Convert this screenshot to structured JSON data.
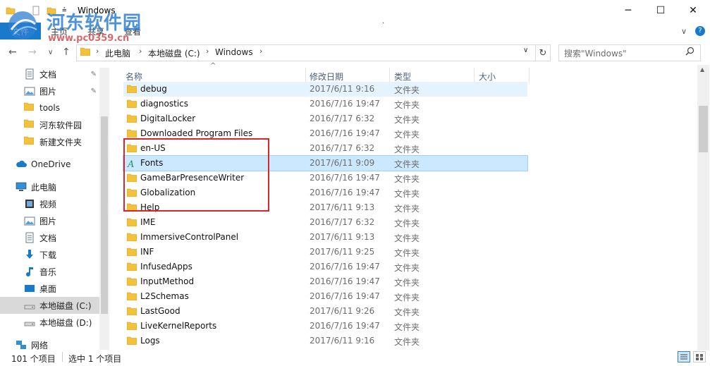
{
  "window": {
    "title": "Windows",
    "minimize_glyph": "─",
    "maximize_glyph": "☐",
    "close_glyph": "✕"
  },
  "ribbon": {
    "file_tab": "文件",
    "tabs": [
      "主页",
      "共享",
      "查看"
    ],
    "collapse_glyph": "∨",
    "help_glyph": "?"
  },
  "watermark": {
    "title": "河东软件园",
    "url": "www.pc0359.cn"
  },
  "nav": {
    "back_glyph": "←",
    "forward_glyph": "→",
    "recent_glyph": "∨",
    "up_glyph": "↑",
    "breadcrumbs": [
      "此电脑",
      "本地磁盘 (C:)",
      "Windows"
    ],
    "crumb_sep": "›",
    "dropdown_glyph": "∨",
    "refresh_glyph": "↻"
  },
  "search": {
    "placeholder": "搜索\"Windows\"",
    "icon": "search-icon"
  },
  "sidebar": {
    "items": [
      {
        "label": "文档",
        "icon": "document-icon",
        "pinned": true
      },
      {
        "label": "图片",
        "icon": "picture-icon",
        "pinned": true
      },
      {
        "label": "tools",
        "icon": "folder-icon",
        "pinned": false
      },
      {
        "label": "河东软件园",
        "icon": "folder-icon",
        "pinned": false
      },
      {
        "label": "新建文件夹",
        "icon": "folder-icon",
        "pinned": false
      },
      {
        "label": "OneDrive",
        "icon": "cloud-icon",
        "pinned": false
      },
      {
        "label": "此电脑",
        "icon": "computer-icon",
        "pinned": false
      },
      {
        "label": "视频",
        "icon": "video-icon",
        "pinned": false
      },
      {
        "label": "图片",
        "icon": "picture-icon",
        "pinned": false
      },
      {
        "label": "文档",
        "icon": "document-icon",
        "pinned": false
      },
      {
        "label": "下载",
        "icon": "download-icon",
        "pinned": false
      },
      {
        "label": "音乐",
        "icon": "music-icon",
        "pinned": false
      },
      {
        "label": "桌面",
        "icon": "desktop-icon",
        "pinned": false
      },
      {
        "label": "本地磁盘 (C:)",
        "icon": "drive-icon",
        "pinned": false,
        "selected": true
      },
      {
        "label": "本地磁盘 (D:)",
        "icon": "drive-icon",
        "pinned": false
      },
      {
        "label": "网络",
        "icon": "network-icon",
        "pinned": false
      }
    ],
    "pin_glyph": "✎"
  },
  "columns": {
    "name": "名称",
    "modified": "修改日期",
    "type": "类型",
    "size": "大小",
    "sort_glyph": "^"
  },
  "files": [
    {
      "name": "debug",
      "modified": "2017/6/11 9:16",
      "type": "文件夹",
      "icon": "folder-icon",
      "state": "hover"
    },
    {
      "name": "diagnostics",
      "modified": "2016/7/16 19:47",
      "type": "文件夹",
      "icon": "folder-icon"
    },
    {
      "name": "DigitalLocker",
      "modified": "2016/7/17 6:32",
      "type": "文件夹",
      "icon": "folder-icon"
    },
    {
      "name": "Downloaded Program Files",
      "modified": "2016/7/16 19:47",
      "type": "文件夹",
      "icon": "folder-icon"
    },
    {
      "name": "en-US",
      "modified": "2016/7/17 6:32",
      "type": "文件夹",
      "icon": "folder-icon"
    },
    {
      "name": "Fonts",
      "modified": "2017/6/11 9:09",
      "type": "文件夹",
      "icon": "fonts-folder-icon",
      "state": "selected"
    },
    {
      "name": "GameBarPresenceWriter",
      "modified": "2016/7/16 19:47",
      "type": "文件夹",
      "icon": "folder-icon"
    },
    {
      "name": "Globalization",
      "modified": "2016/7/16 19:47",
      "type": "文件夹",
      "icon": "folder-icon"
    },
    {
      "name": "Help",
      "modified": "2017/6/11 9:13",
      "type": "文件夹",
      "icon": "folder-icon"
    },
    {
      "name": "IME",
      "modified": "2016/7/17 6:32",
      "type": "文件夹",
      "icon": "folder-icon"
    },
    {
      "name": "ImmersiveControlPanel",
      "modified": "2017/6/11 9:13",
      "type": "文件夹",
      "icon": "folder-icon"
    },
    {
      "name": "INF",
      "modified": "2017/6/11 9:25",
      "type": "文件夹",
      "icon": "folder-icon"
    },
    {
      "name": "InfusedApps",
      "modified": "2016/7/16 19:47",
      "type": "文件夹",
      "icon": "folder-icon"
    },
    {
      "name": "InputMethod",
      "modified": "2016/7/16 19:47",
      "type": "文件夹",
      "icon": "folder-icon"
    },
    {
      "name": "L2Schemas",
      "modified": "2016/7/16 19:47",
      "type": "文件夹",
      "icon": "folder-icon"
    },
    {
      "name": "LastGood",
      "modified": "2017/6/11 9:26",
      "type": "文件夹",
      "icon": "folder-icon"
    },
    {
      "name": "LiveKernelReports",
      "modified": "2016/7/16 19:47",
      "type": "文件夹",
      "icon": "folder-icon"
    },
    {
      "name": "Logs",
      "modified": "2017/6/11 9:16",
      "type": "文件夹",
      "icon": "folder-icon"
    }
  ],
  "status": {
    "item_count": "101 个项目",
    "selected": "选中 1 个项目"
  },
  "colors": {
    "accent": "#1979ca",
    "selection": "#cce8ff",
    "hover": "#e5f3ff",
    "highlight_box": "#d9252b",
    "folder": "#f3c13a"
  }
}
